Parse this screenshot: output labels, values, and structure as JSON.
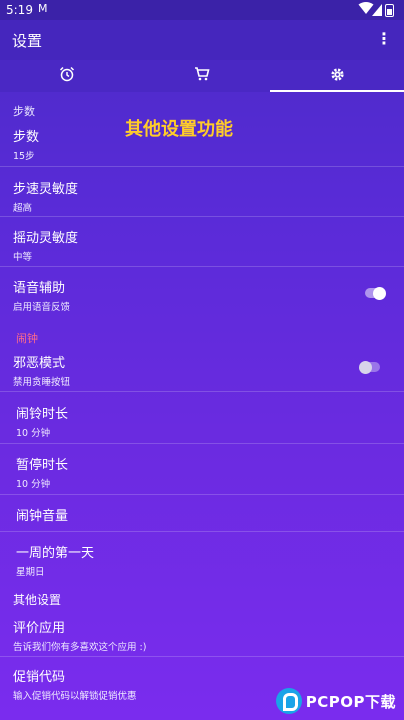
{
  "status_bar": {
    "time": "5:19",
    "mail_icon": "M"
  },
  "app_bar": {
    "title": "设置",
    "more_icon": "⋮"
  },
  "tabs": [
    {
      "icon": "alarm-icon"
    },
    {
      "icon": "cart-icon"
    },
    {
      "icon": "gear-icon",
      "active": true
    }
  ],
  "overlay_text": "其他设置功能",
  "steps_section": {
    "header": "步数",
    "items": [
      {
        "title": "步数",
        "subtitle": "15步"
      },
      {
        "title": "步速灵敏度",
        "subtitle": "超高"
      },
      {
        "title": "摇动灵敏度",
        "subtitle": "中等"
      },
      {
        "title": "语音辅助",
        "subtitle": "启用语音反馈",
        "toggle": true
      }
    ]
  },
  "alarm_section": {
    "header": "闹钟",
    "items": [
      {
        "title": "邪恶模式",
        "subtitle": "禁用贪睡按钮",
        "toggle": false
      },
      {
        "title": "闹铃时长",
        "subtitle": "10 分钟"
      },
      {
        "title": "暂停时长",
        "subtitle": "10 分钟"
      },
      {
        "title": "闹钟音量",
        "subtitle": ""
      },
      {
        "title": "一周的第一天",
        "subtitle": "星期日"
      }
    ]
  },
  "other_section": {
    "header": "其他设置",
    "items": [
      {
        "title": "评价应用",
        "subtitle": "告诉我们你有多喜欢这个应用 :)"
      },
      {
        "title": "促销代码",
        "subtitle": "输入促销代码以解锁促销优惠"
      }
    ]
  },
  "watermark": {
    "text": "PCPOP下载"
  },
  "colors": {
    "accent_red": "#ff6b8a",
    "promo_yellow": "#ffcc2a",
    "toggle_on": "#ffffff",
    "toggle_off": "#d8d4ea"
  }
}
